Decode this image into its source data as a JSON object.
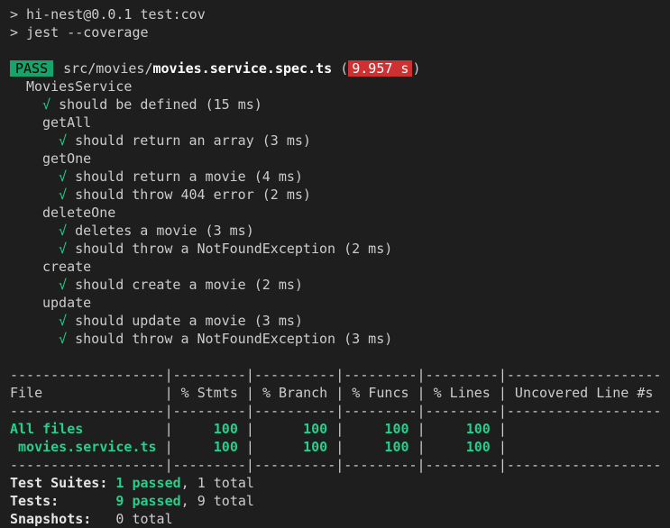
{
  "cmd1": "> hi-nest@0.0.1 test:cov",
  "cmd2": "> jest --coverage",
  "result": {
    "badge": "PASS",
    "path_dir": "src/movies/",
    "path_file": "movies.service.spec.ts",
    "time": "9.957 s"
  },
  "suite": {
    "name": "MoviesService",
    "top_tests": [
      "should be defined (15 ms)"
    ],
    "groups": [
      {
        "name": "getAll",
        "tests": [
          "should return an array (3 ms)"
        ]
      },
      {
        "name": "getOne",
        "tests": [
          "should return a movie (4 ms)",
          "should throw 404 error (2 ms)"
        ]
      },
      {
        "name": "deleteOne",
        "tests": [
          "deletes a movie (3 ms)",
          "should throw a NotFoundException (2 ms)"
        ]
      },
      {
        "name": "create",
        "tests": [
          "should create a movie (2 ms)"
        ]
      },
      {
        "name": "update",
        "tests": [
          "should update a movie (3 ms)",
          "should throw a NotFoundException (3 ms)"
        ]
      }
    ]
  },
  "check_glyph": "√",
  "coverage": {
    "separator": "-------------------|---------|----------|---------|---------|-------------------",
    "header": "File               | % Stmts | % Branch | % Funcs | % Lines | Uncovered Line #s ",
    "rows": [
      {
        "file": "All files",
        "stmts": "100",
        "branch": "100",
        "funcs": "100",
        "lines": "100",
        "uncovered": ""
      },
      {
        "file": " movies.service.ts",
        "stmts": "100",
        "branch": "100",
        "funcs": "100",
        "lines": "100",
        "uncovered": ""
      }
    ]
  },
  "summary": {
    "suites_label": "Test Suites:",
    "suites_passed": "1 passed",
    "suites_total": ", 1 total",
    "tests_label": "Tests:",
    "tests_passed": "9 passed",
    "tests_total": ", 9 total",
    "snapshots_label": "Snapshots:",
    "snapshots_value": "0 total"
  }
}
